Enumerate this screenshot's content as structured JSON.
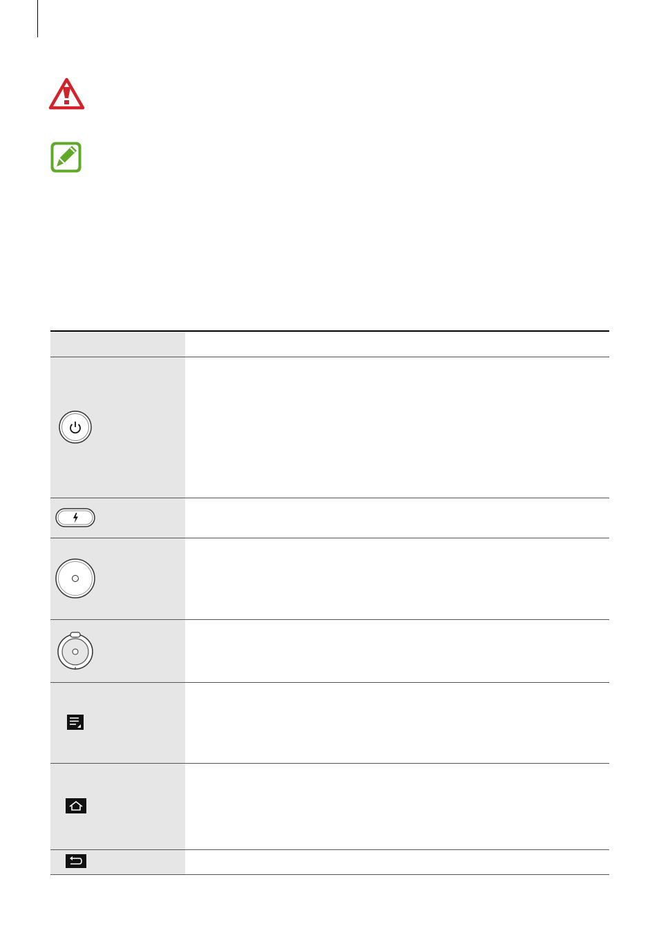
{
  "notices": [
    {
      "icon": "warning-icon",
      "color": "#d2232a"
    },
    {
      "icon": "note-icon",
      "color": "#5fa828"
    }
  ],
  "keys_table": {
    "header": {
      "key": "",
      "function": ""
    },
    "rows": [
      {
        "icon": "power-button-icon",
        "function": ""
      },
      {
        "icon": "flash-button-icon",
        "function": ""
      },
      {
        "icon": "shutter-button-icon",
        "function": ""
      },
      {
        "icon": "zoom-ring-icon",
        "function": ""
      },
      {
        "icon": "menu-key-icon",
        "function": ""
      },
      {
        "icon": "home-key-icon",
        "function": ""
      },
      {
        "icon": "back-key-icon",
        "function": ""
      }
    ]
  },
  "colors": {
    "key_column_bg": "#e6e6e6",
    "rule": "#000000"
  }
}
